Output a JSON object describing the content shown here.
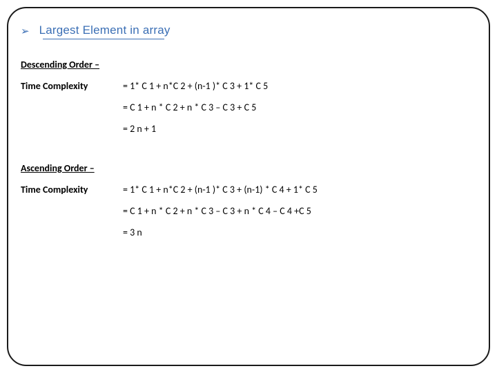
{
  "title": "Largest Element in array",
  "sections": [
    {
      "heading": "Descending Order –",
      "label": "Time Complexity",
      "equations": [
        "= 1* C 1 + n*C 2 + (n-1 )* C 3  + 1* C 5",
        "= C 1 + n * C 2 + n * C 3 – C 3 + C 5",
        "= 2 n + 1"
      ]
    },
    {
      "heading": "Ascending Order –",
      "label": "Time Complexity",
      "equations": [
        "= 1* C 1 + n*C 2 + (n-1 )* C 3 + (n-1) * C 4 + 1* C 5",
        "= C 1 + n * C 2 + n * C 3 – C 3 + n * C 4 – C 4 +C 5",
        "= 3 n"
      ]
    }
  ]
}
